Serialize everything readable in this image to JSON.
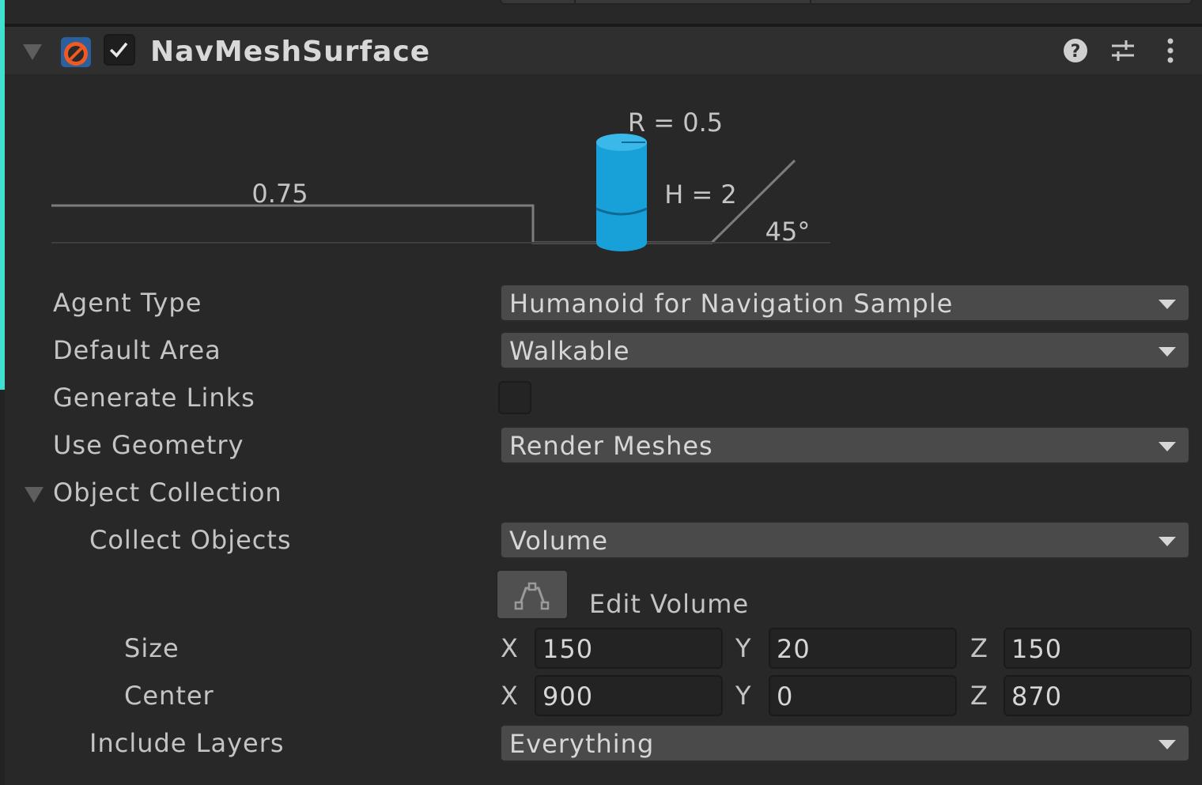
{
  "component": {
    "title": "NavMeshSurface",
    "enabled": true,
    "icon": "navmesh-surface-icon"
  },
  "header_icons": [
    "help-icon",
    "preset-sliders-icon",
    "kebab-menu-icon"
  ],
  "diagram": {
    "radius_label": "R = 0.5",
    "height_label": "H = 2",
    "step_label": "0.75",
    "slope_label": "45°",
    "agent_color": "#18a0d8"
  },
  "fields": {
    "agent_type": {
      "label": "Agent Type",
      "value": "Humanoid for Navigation Sample"
    },
    "default_area": {
      "label": "Default Area",
      "value": "Walkable"
    },
    "generate_links": {
      "label": "Generate Links",
      "checked": false
    },
    "use_geometry": {
      "label": "Use Geometry",
      "value": "Render Meshes"
    },
    "object_collection": {
      "label": "Object Collection",
      "expanded": true
    },
    "collect_objects": {
      "label": "Collect Objects",
      "value": "Volume"
    },
    "edit_volume": {
      "label": "Edit Volume",
      "icon": "edit-bounds-icon"
    },
    "size": {
      "label": "Size",
      "x_label": "X",
      "y_label": "Y",
      "z_label": "Z",
      "x": "150",
      "y": "20",
      "z": "150"
    },
    "center": {
      "label": "Center",
      "x_label": "X",
      "y_label": "Y",
      "z_label": "Z",
      "x": "900",
      "y": "0",
      "z": "870"
    },
    "include_layers": {
      "label": "Include Layers",
      "value": "Everything"
    }
  }
}
